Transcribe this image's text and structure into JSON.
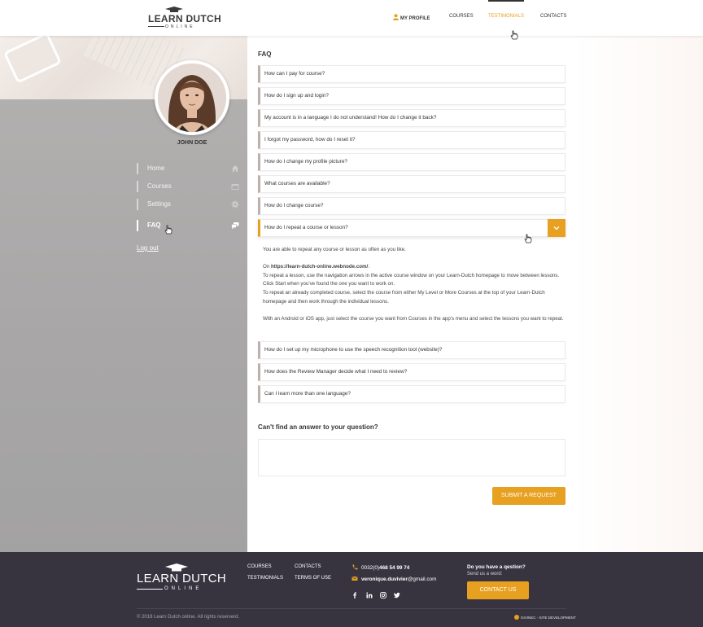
{
  "header": {
    "logo_line1": "LEARN DUTCH",
    "logo_line2": "ONLINE",
    "nav": {
      "profile": "MY PROFILE",
      "courses": "COURSES",
      "testimonials": "TESTIMONIALS",
      "contacts": "CONTACTS"
    },
    "active_nav": "testimonials"
  },
  "sidebar": {
    "user_name": "JOHN DOE",
    "items": [
      {
        "label": "Home",
        "icon": "home-icon"
      },
      {
        "label": "Courses",
        "icon": "folder-icon"
      },
      {
        "label": "Settings",
        "icon": "gear-icon"
      },
      {
        "label": "FAQ",
        "icon": "chat-icon",
        "active": true
      }
    ],
    "logout": "Log out"
  },
  "faq": {
    "title": "FAQ",
    "items": [
      {
        "question": "How can I pay for course?"
      },
      {
        "question": "How do I sign up and login?"
      },
      {
        "question": "My account is in a language I do not understand! How do I change it back?"
      },
      {
        "question": "I forgot my password, how do I reset it?"
      },
      {
        "question": "How do I change my profile picture?"
      },
      {
        "question": "What courses are available?"
      },
      {
        "question": "How do I change course?"
      },
      {
        "question": "How do I repeat a course or lesson?",
        "open": true
      },
      {
        "question": "How do I set up my microphone to use the speech recognition tool (website)?"
      },
      {
        "question": "How does the Review Manager decide what I need to review?"
      },
      {
        "question": "Can I learn more than one language?"
      }
    ],
    "answer": {
      "p1": "You are able to repeat any course or lesson as often as you like.",
      "on_prefix": "On ",
      "on_link": "https://learn-dutch-online.webnode.com/",
      "on_suffix": ":",
      "p2": "To repeat a lesson, use the navigation arrows in the active course window on your Learn-Dutch homepage to move between lessons. Click Start when you've found the one you want to work on.",
      "p3": "To repeat an already completed course, select the course from either My Level or More Courses at the top of your Learn-Dutch homepage and then work through the individual lessons.",
      "p4": "With an Android or iOS app, just select the course you want from Courses in the app's menu and select the lessons you want to repeat."
    }
  },
  "ask": {
    "title": "Can't find an answer to your question?",
    "placeholder": "",
    "submit": "SUBMIT A REQUEST"
  },
  "footer": {
    "logo_line1": "LEARN DUTCH",
    "logo_line2": "ONLINE",
    "links": {
      "courses": "COURSES",
      "contacts": "CONTACTS",
      "testimonials": "TESTIMONIALS",
      "terms": "TERMS OF USE"
    },
    "phone_prefix": "0032(0)",
    "phone_main": "468 54 99 74",
    "email_name": "veronique.duvivier",
    "email_domain": "@gmail.com",
    "social": [
      "facebook-icon",
      "linkedin-icon",
      "instagram-icon",
      "twitter-icon"
    ],
    "question_title": "Do you have a qestion?",
    "question_sub": "Send us a word:",
    "contact_button": "CONTACT US",
    "copyright": "© 2018 Learn Dutch online. All rights reserverd.",
    "credit": "GIVINEC - SITE DEVELOPMENT"
  },
  "colors": {
    "accent": "#e8a020",
    "footer_bg": "#373440",
    "sidebar_bg": "#a9a7a7"
  }
}
